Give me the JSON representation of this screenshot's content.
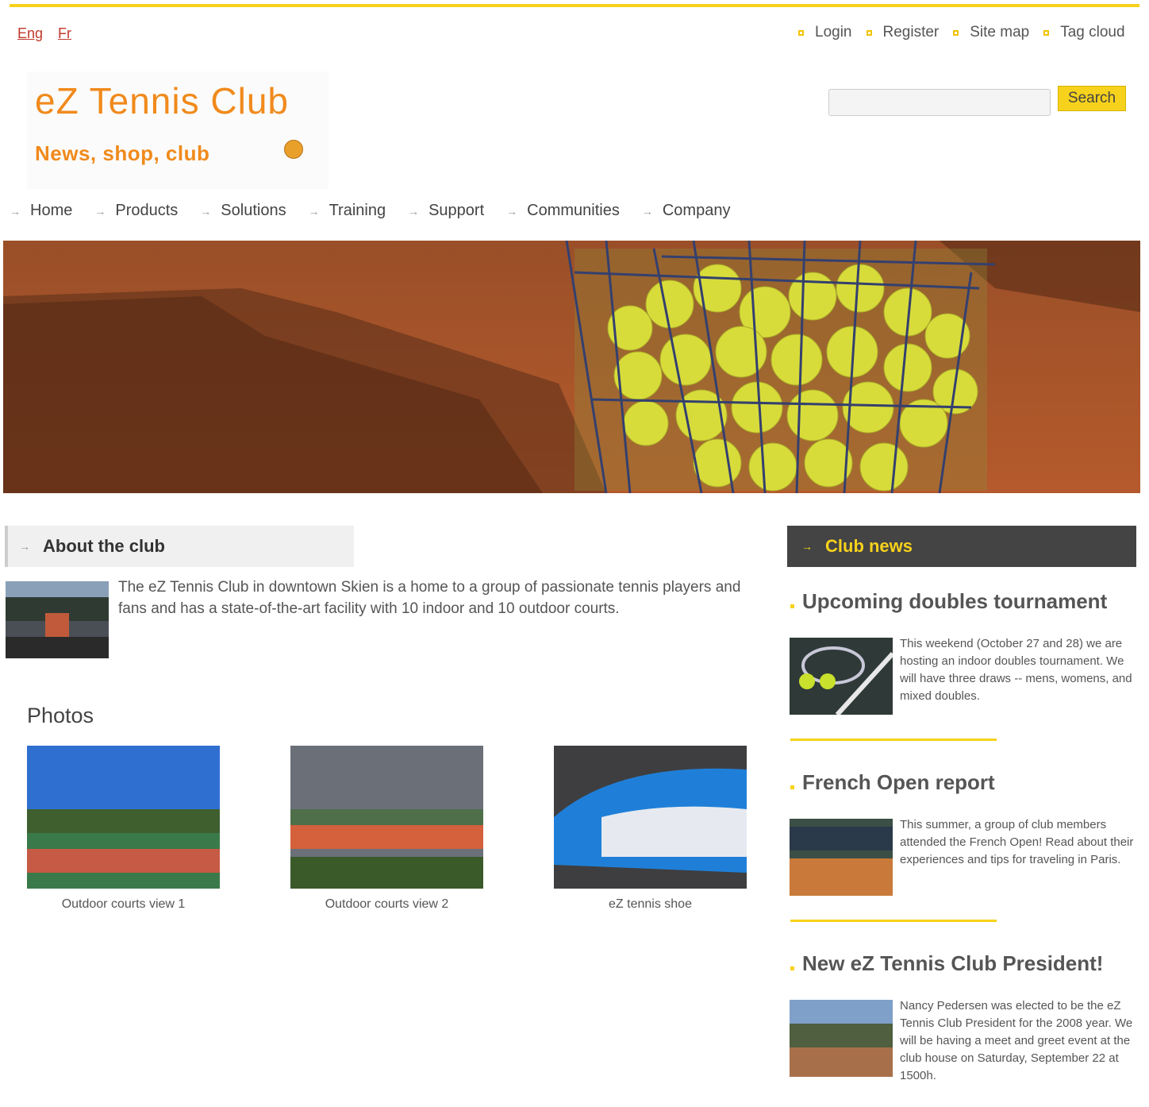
{
  "lang": {
    "eng": "Eng",
    "fr": "Fr"
  },
  "util_links": [
    "Login",
    "Register",
    "Site map",
    "Tag cloud"
  ],
  "logo": {
    "title": "eZ Tennis Club",
    "subtitle": "News, shop, club"
  },
  "search": {
    "button": "Search",
    "placeholder": ""
  },
  "nav": [
    "Home",
    "Products",
    "Solutions",
    "Training",
    "Support",
    "Communities",
    "Company"
  ],
  "about": {
    "heading": "About the club",
    "text": "The eZ Tennis Club in downtown Skien is a home to a group of passionate tennis players and fans and has a state-of-the-art facility with 10 indoor and 10 outdoor courts."
  },
  "photos": {
    "heading": "Photos",
    "items": [
      {
        "caption": "Outdoor courts view 1"
      },
      {
        "caption": "Outdoor courts view 2"
      },
      {
        "caption": "eZ tennis shoe"
      }
    ]
  },
  "news": {
    "heading": "Club news",
    "items": [
      {
        "title": "Upcoming doubles tournament",
        "text": "This weekend (October 27 and 28) we are hosting an indoor doubles tournament. We will have three draws -- mens, womens, and mixed doubles."
      },
      {
        "title": "French Open report",
        "text": "This summer, a group of club members attended the French Open! Read about their experiences and tips for traveling in Paris."
      },
      {
        "title": "New eZ Tennis Club President!",
        "text": "Nancy Pedersen was elected to be the eZ Tennis Club President for the 2008 year. We will be having a meet and greet event at the club house on Saturday, September 22 at 1500h."
      }
    ]
  },
  "colors": {
    "accent": "#f7d21c",
    "logo": "#f08a1c",
    "dark": "#444444"
  }
}
